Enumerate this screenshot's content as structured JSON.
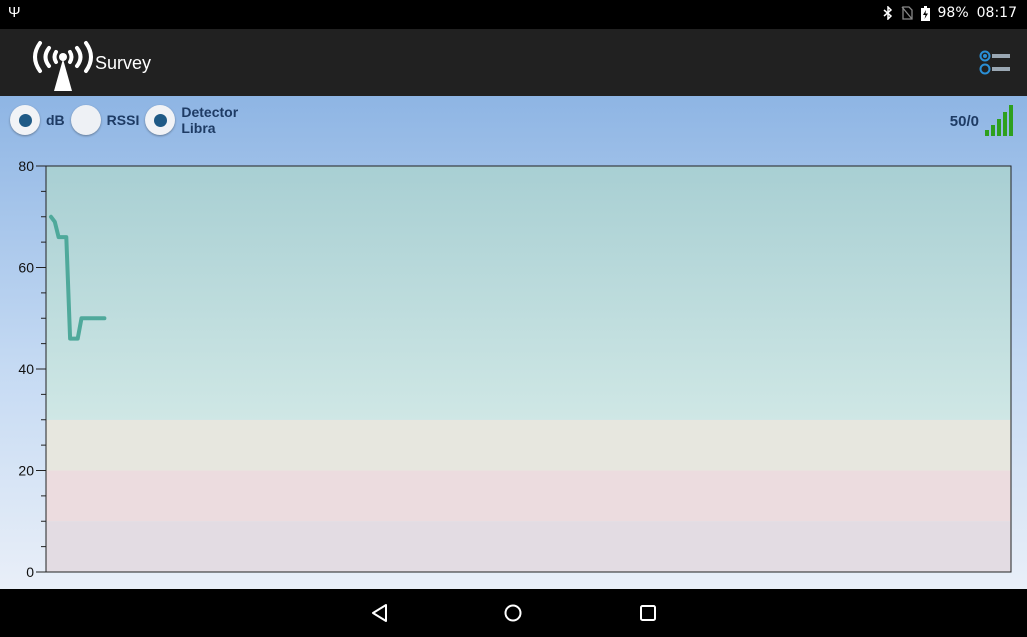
{
  "status_bar": {
    "battery": "98%",
    "time": "08:17",
    "icons": [
      "usb-icon",
      "bluetooth-icon",
      "no-sim-icon",
      "battery-icon"
    ]
  },
  "app_bar": {
    "title": "Survey",
    "logo_icon": "radio-tower-icon",
    "menu_icon": "settings-list-icon"
  },
  "modes": {
    "db_label": "dB",
    "rssi_label": "RSSI",
    "detector_label": "Detector",
    "detector_sub": "Libra",
    "selected": [
      "dB",
      "Detector"
    ]
  },
  "count": {
    "text": "50/0",
    "icon": "signal-bars-icon",
    "color": "#2ea01e"
  },
  "chart_data": {
    "type": "line",
    "ylim": [
      0,
      80
    ],
    "y_ticks": [
      0,
      20,
      40,
      60,
      80
    ],
    "series": [
      {
        "color": "#4fa99b",
        "points": [
          [
            0,
            70
          ],
          [
            1,
            69
          ],
          [
            2,
            66
          ],
          [
            3,
            66
          ],
          [
            4,
            66
          ],
          [
            5,
            46
          ],
          [
            6,
            46
          ],
          [
            7,
            46
          ],
          [
            8,
            50
          ],
          [
            9,
            50
          ],
          [
            10,
            50
          ],
          [
            11,
            50
          ],
          [
            12,
            50
          ],
          [
            13,
            50
          ],
          [
            14,
            50
          ]
        ]
      }
    ],
    "x_max": 253,
    "bands": [
      {
        "from": 0,
        "to": 10,
        "color": "#e3dce3"
      },
      {
        "from": 10,
        "to": 20,
        "color": "#ecdcdf"
      },
      {
        "from": 20,
        "to": 30,
        "color": "#e7e7df"
      },
      {
        "from": 30,
        "to": 80,
        "color": "#a8cfd3",
        "color_top": "#a8cfd3",
        "color_bottom": "#cfe7e5"
      }
    ],
    "grid": false
  },
  "nav_bar": {
    "icons": [
      "back-icon",
      "home-icon",
      "recents-icon"
    ]
  }
}
